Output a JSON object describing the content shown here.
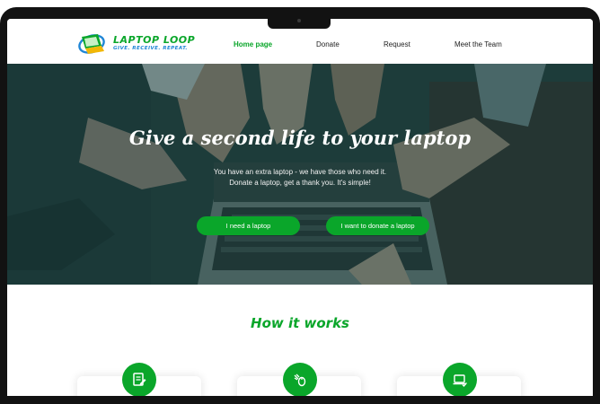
{
  "brand": {
    "name": "LAPTOP LOOP",
    "tagline": "GIVE. RECEIVE. REPEAT.",
    "primary_color": "#0aa62a",
    "tagline_color": "#1f86d6"
  },
  "nav": {
    "items": [
      {
        "label": "Home page",
        "active": true
      },
      {
        "label": "Donate",
        "active": false
      },
      {
        "label": "Request",
        "active": false
      },
      {
        "label": "Meet the Team",
        "active": false
      }
    ]
  },
  "hero": {
    "title": "Give a second life to your laptop",
    "subtitle_line1": "You have an extra laptop - we have those who need it.",
    "subtitle_line2": "Donate a laptop, get a thank you. It's simple!",
    "button_need": "I need a laptop",
    "button_donate": "I want to donate a laptop"
  },
  "how_it_works": {
    "title": "How it works",
    "steps": [
      {
        "icon": "document-edit-icon"
      },
      {
        "icon": "hand-with-mouse-icon"
      },
      {
        "icon": "laptop-check-icon"
      }
    ]
  }
}
